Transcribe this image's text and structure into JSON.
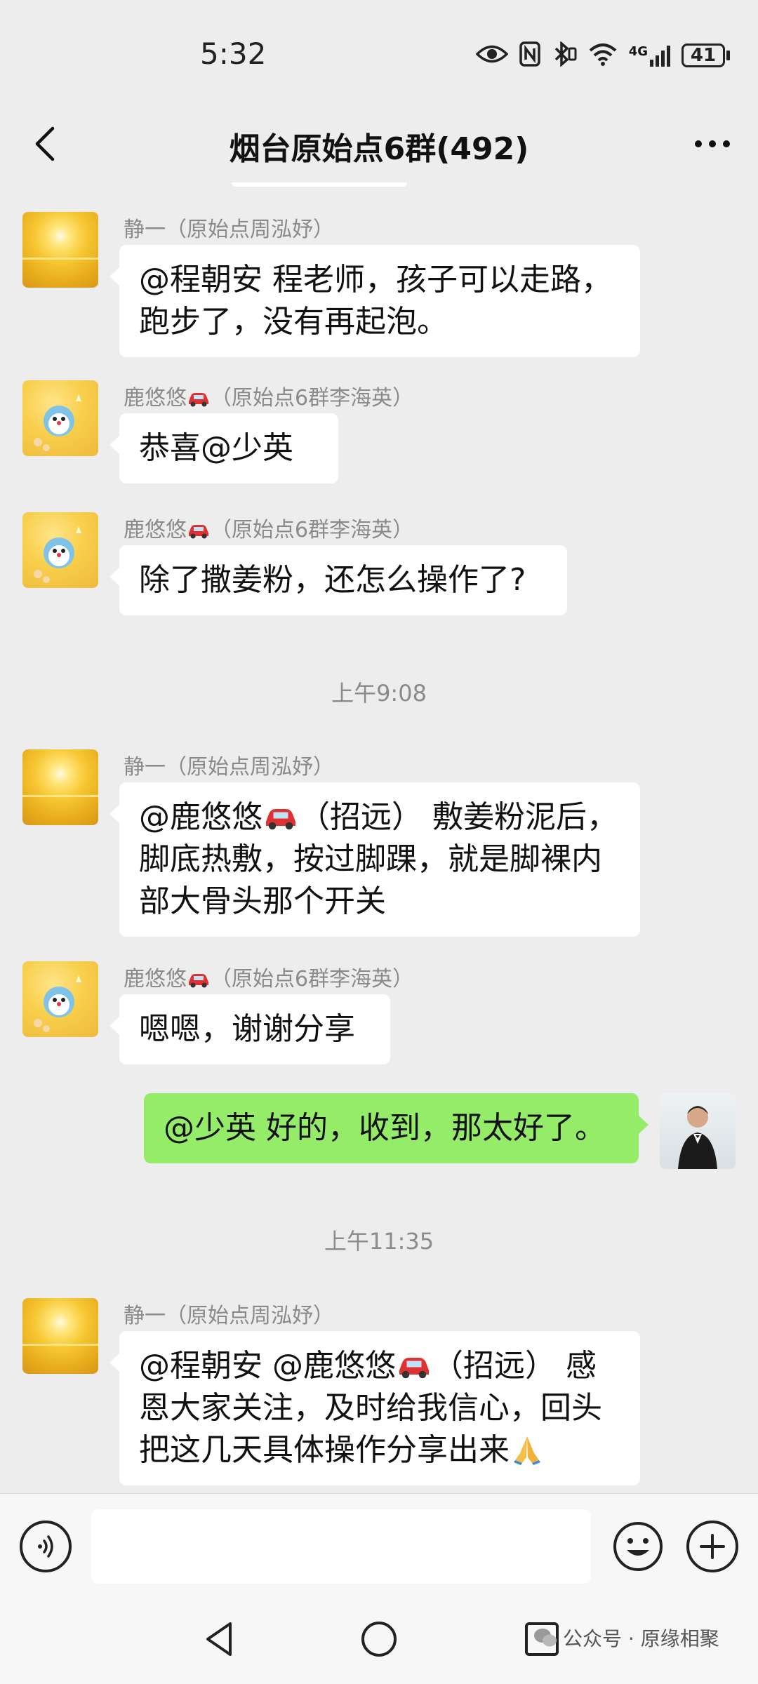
{
  "status_bar": {
    "time": "5:32",
    "network_label": "4G",
    "battery_level": "41"
  },
  "header": {
    "title": "烟台原始点6群(492)"
  },
  "messages": [
    {
      "sender": "静一（原始点周泓妤）",
      "text_lines": [
        "@程朝安  程老师，孩子可以走路，",
        "跑步了，没有再起泡。"
      ]
    },
    {
      "sender_prefix": "鹿悠悠",
      "sender_suffix": "（原始点6群李海英）",
      "text_lines": [
        "恭喜@少英"
      ]
    },
    {
      "sender_prefix": "鹿悠悠",
      "sender_suffix": "（原始点6群李海英）",
      "text_lines": [
        "除了撒姜粉，还怎么操作了?"
      ]
    },
    {
      "timestamp": "上午9:08"
    },
    {
      "sender": "静一（原始点周泓妤）",
      "line1_prefix": "@鹿悠悠",
      "line1_suffix": "（招远） 敷姜粉泥后，",
      "text_lines": [
        "脚底热敷，按过脚踝，就是脚裸内",
        "部大骨头那个开关"
      ]
    },
    {
      "sender_prefix": "鹿悠悠",
      "sender_suffix": "（原始点6群李海英）",
      "text_lines": [
        "嗯嗯，谢谢分享"
      ]
    },
    {
      "self_text": "@少英  好的，收到，那太好了。"
    },
    {
      "timestamp": "上午11:35"
    },
    {
      "sender": "静一（原始点周泓妤）",
      "line1_prefix": "@程朝安 @鹿悠悠",
      "line1_suffix": "（招远） 感",
      "text_lines": [
        "恩大家关注，及时给我信心，回头",
        "把这几天具体操作分享出来"
      ]
    }
  ],
  "watermark": {
    "text": "公众号 · 原缘相聚"
  },
  "icons": {
    "car": "red-car-emoji",
    "pray": "folded-hands-emoji"
  },
  "colors": {
    "background": "#ededed",
    "self_bubble": "#95ec69",
    "other_bubble": "#ffffff"
  }
}
